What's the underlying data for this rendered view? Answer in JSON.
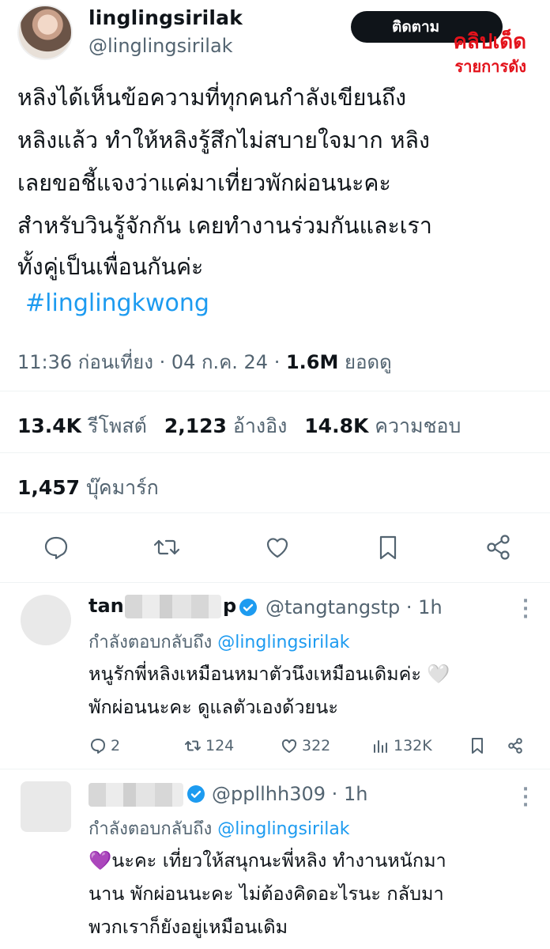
{
  "header": {
    "display_name": "linglingsirilak",
    "handle": "@linglingsirilak",
    "follow_label": "ติดตาม"
  },
  "watermark": {
    "line1": "คลิปเด็ด",
    "line2": "รายการดัง",
    "color": "#e3121b"
  },
  "tweet": {
    "lines": [
      "หลิงได้เห็นข้อความที่ทุกคนกำลังเขียนถึง",
      "หลิงแล้ว ทำให้หลิงรู้สึกไม่สบายใจมาก หลิง",
      "เลยขอชี้แจงว่าแค่มาเที่ยวพักผ่อนนะคะ",
      "สำหรับวินรู้จักกัน เคยทำงานร่วมกันและเรา",
      "ทั้งคู่เป็นเพื่อนกันค่ะ"
    ],
    "hashtag": "#linglingkwong",
    "time": "11:36 ก่อนเที่ยง",
    "date": "04 ก.ค. 24",
    "views_count": "1.6M",
    "views_label": "ยอดดู"
  },
  "stats": {
    "reposts_count": "13.4K",
    "reposts_label": "รีโพสต์",
    "quotes_count": "2,123",
    "quotes_label": "อ้างอิง",
    "likes_count": "14.8K",
    "likes_label": "ความชอบ",
    "bookmarks_count": "1,457",
    "bookmarks_label": "บุ๊คมาร์ก"
  },
  "actions": [
    "reply-icon",
    "repost-icon",
    "like-icon",
    "bookmark-icon",
    "share-icon"
  ],
  "replies": [
    {
      "name_partial_start": "tan",
      "name_partial_end": "p",
      "handle": "@tangtangstp",
      "age": "1h",
      "replying_prefix": "กำลังตอบกลับถึง",
      "replying_to": "@linglingsirilak",
      "lines": [
        "หนูรักพี่หลิงเหมือนหมาตัวนึงเหมือนเดิมค่ะ 🤍",
        "พักผ่อนนะคะ ดูแลตัวเองด้วยนะ"
      ],
      "replies_count": "2",
      "reposts_count": "124",
      "likes_count": "322",
      "views_count": "132K"
    },
    {
      "handle": "@ppllhh309",
      "age": "1h",
      "replying_prefix": "กำลังตอบกลับถึง",
      "replying_to": "@linglingsirilak",
      "lines": [
        "💜นะคะ เที่ยวให้สนุกนะพี่หลิง ทำงานหนักมา",
        "นาน พักผ่อนนะคะ ไม่ต้องคิดอะไรนะ กลับมา",
        "พวกเราก็ยังอยู่เหมือนเดิม"
      ]
    }
  ],
  "colors": {
    "link": "#1d9bf0",
    "secondary_text": "#536471",
    "verified": "#1d9bf0"
  }
}
